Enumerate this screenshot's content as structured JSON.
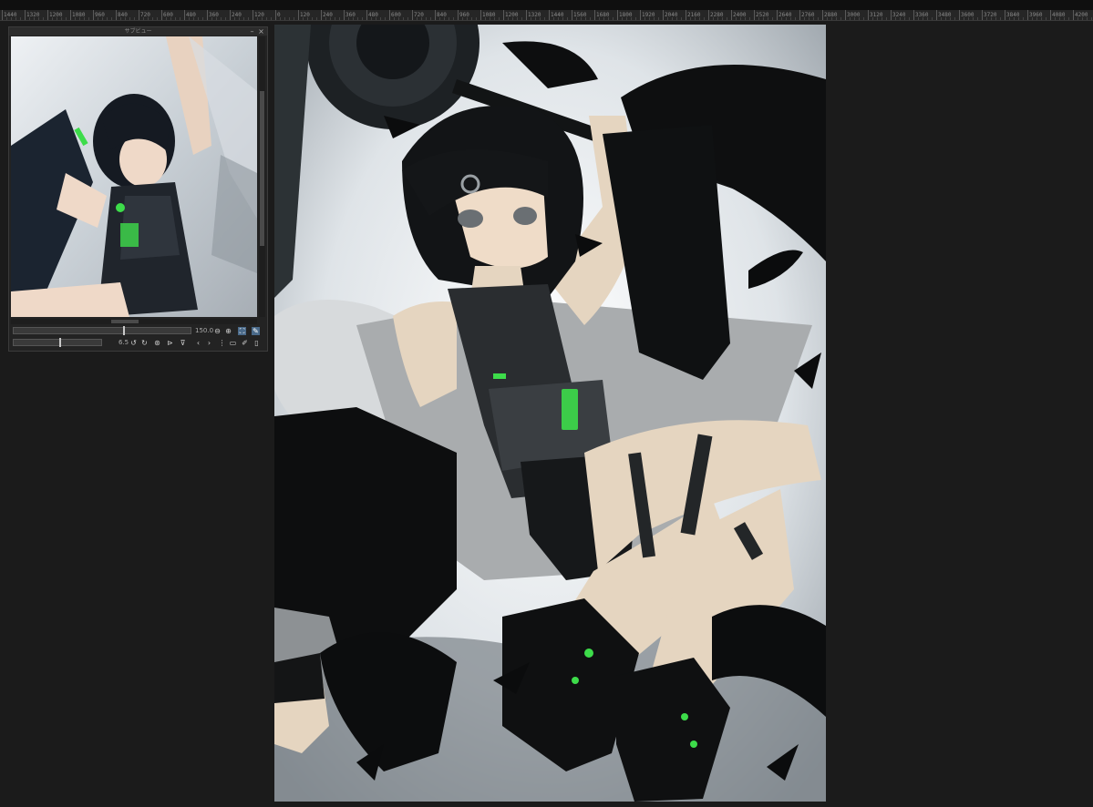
{
  "ruler": {
    "labels": [
      "1440",
      "1320",
      "1200",
      "1080",
      "960",
      "840",
      "720",
      "600",
      "480",
      "360",
      "240",
      "120",
      "0",
      "120",
      "240",
      "360",
      "480",
      "600",
      "720",
      "840",
      "960",
      "1080",
      "1200",
      "1320",
      "1440",
      "1560",
      "1680",
      "1800",
      "1920",
      "2040",
      "2160",
      "2280",
      "2400",
      "2520",
      "2640",
      "2760",
      "2880",
      "3000",
      "3120",
      "3240",
      "3360",
      "3480",
      "3600",
      "3720",
      "3840",
      "3960",
      "4080",
      "4200"
    ]
  },
  "navigator": {
    "title": "サブビュー",
    "zoom_value": "150.0",
    "rotation_value": "6.5",
    "zoom_out_icon": "minus-circle-icon",
    "zoom_in_icon": "plus-circle-icon",
    "fit_icon": "fit-window-icon",
    "eyedropper_icon": "eyedropper-icon",
    "rotate_left_icon": "rotate-left-icon",
    "rotate_right_icon": "rotate-right-icon",
    "reset_rotation_icon": "reset-rotation-icon",
    "flip_h_icon": "flip-horizontal-icon",
    "flip_v_icon": "flip-vertical-icon",
    "prev_icon": "chevron-left-icon",
    "next_icon": "chevron-right-icon",
    "grid_icon": "grid-icon",
    "open_icon": "folder-open-icon",
    "edit_icon": "edit-icon",
    "delete_icon": "trash-icon"
  },
  "canvas": {
    "accent": "#3ddc4a"
  }
}
